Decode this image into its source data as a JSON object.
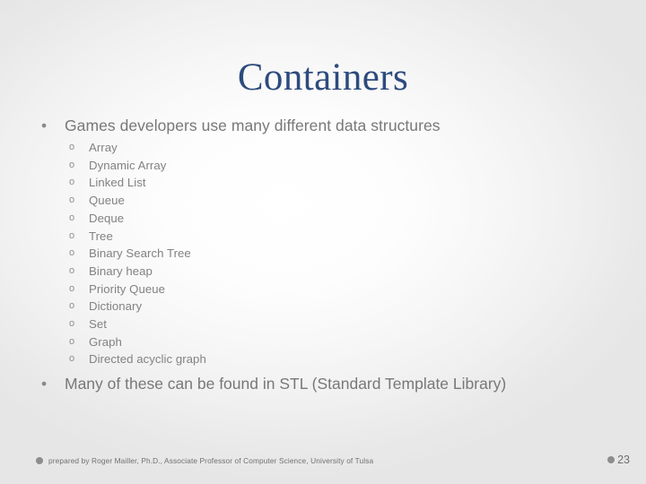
{
  "slide": {
    "title": "Containers",
    "title_color": "#2d4b7d",
    "body_color": "#787878",
    "background_edge_color": "#e6e6e6",
    "background_center_color": "#ffffff"
  },
  "bullets": [
    {
      "marker": "•",
      "text": "Games developers use many different data structures",
      "sub_marker": "o",
      "sub_items": [
        "Array",
        "Dynamic Array",
        "Linked List",
        "Queue",
        "Deque",
        "Tree",
        "Binary Search Tree",
        "Binary heap",
        "Priority Queue",
        "Dictionary",
        "Set",
        "Graph",
        "Directed acyclic graph"
      ]
    },
    {
      "marker": "•",
      "text": "Many of these can be found in STL (Standard Template Library)",
      "sub_items": []
    }
  ],
  "footer": {
    "bullet_icon": "filled-circle-icon",
    "text": "prepared by Roger Mailler, Ph.D., Associate Professor of Computer Science, University of Tulsa",
    "page_bullet_icon": "filled-circle-icon",
    "page_number": "23"
  }
}
